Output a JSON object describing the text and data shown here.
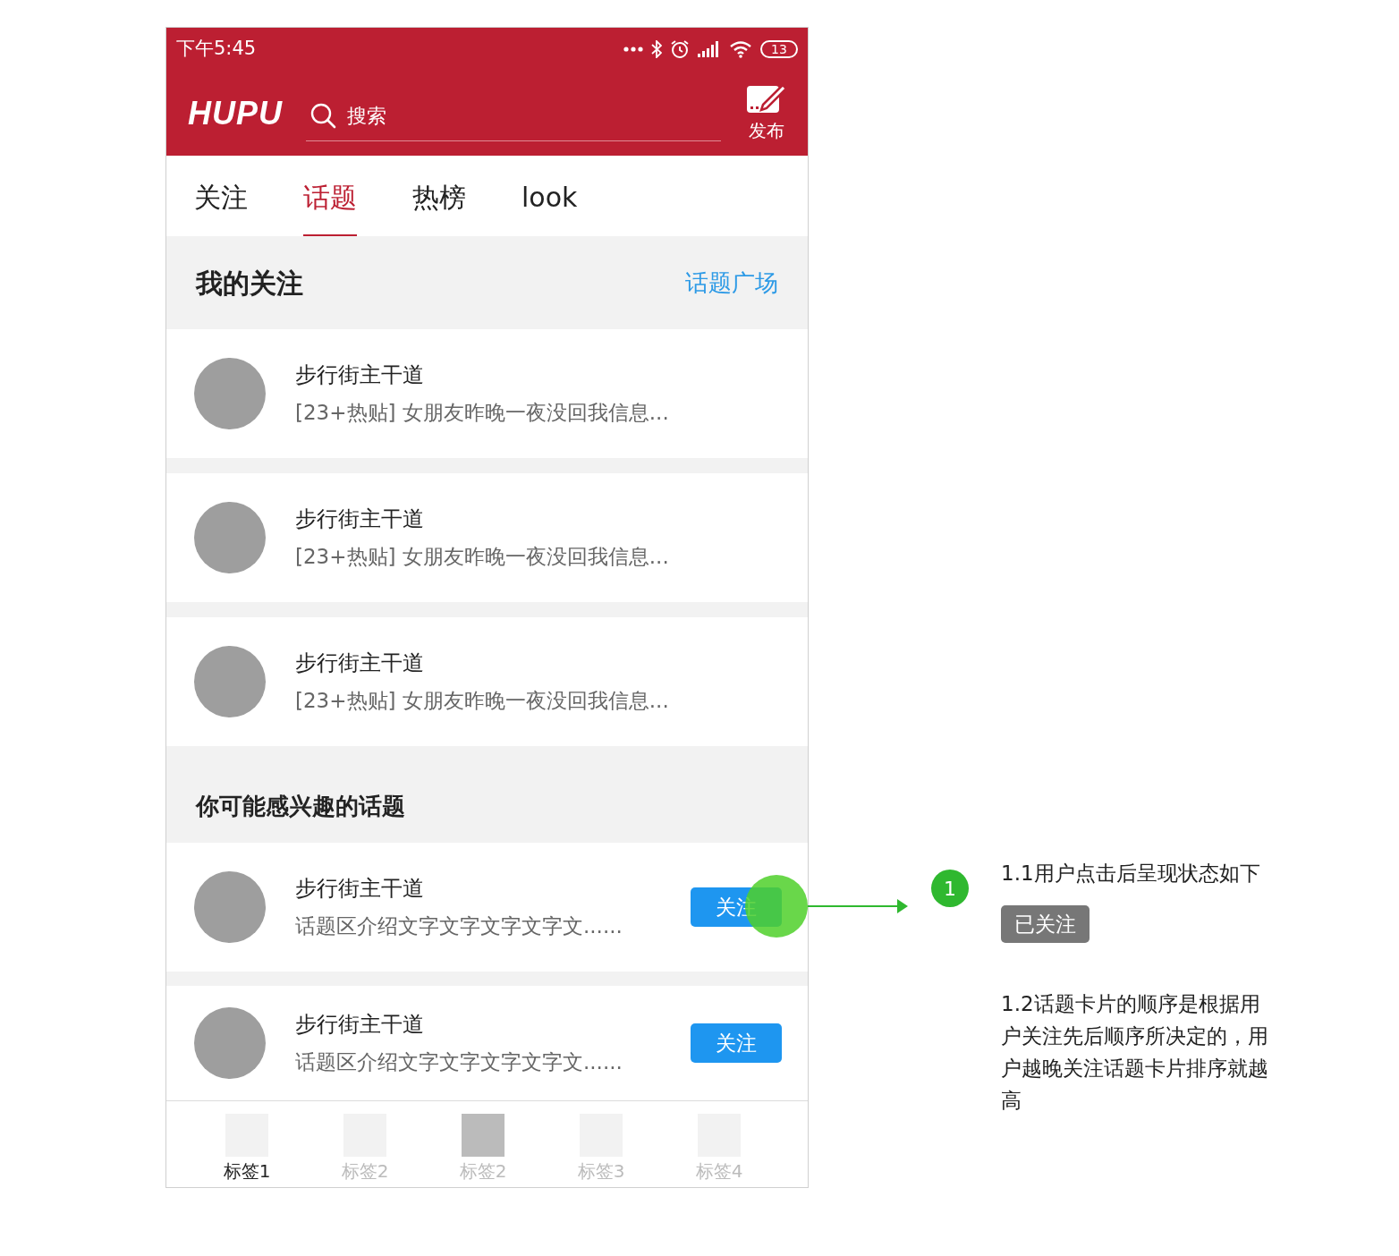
{
  "status_bar": {
    "time": "下午5:45",
    "battery": "13"
  },
  "header": {
    "logo": "HUPU",
    "search": {
      "placeholder": "搜索"
    },
    "publish": "发布"
  },
  "tabs": [
    {
      "label": "关注",
      "selected": false
    },
    {
      "label": "话题",
      "selected": true
    },
    {
      "label": "热榜",
      "selected": false
    },
    {
      "label": "look",
      "selected": false
    }
  ],
  "my_follows": {
    "title": "我的关注",
    "link": "话题广场",
    "items": [
      {
        "title": "步行街主干道",
        "subtitle": "[23+热贴] 女朋友昨晚一夜没回我信息..."
      },
      {
        "title": "步行街主干道",
        "subtitle": "[23+热贴] 女朋友昨晚一夜没回我信息..."
      },
      {
        "title": "步行街主干道",
        "subtitle": "[23+热贴] 女朋友昨晚一夜没回我信息..."
      }
    ]
  },
  "suggested": {
    "title": "你可能感兴趣的话题",
    "items": [
      {
        "title": "步行街主干道",
        "subtitle": "话题区介绍文字文字文字文字文......",
        "button": "关注",
        "touched": true
      },
      {
        "title": "步行街主干道",
        "subtitle": "话题区介绍文字文字文字文字文......",
        "button": "关注",
        "touched": false
      }
    ]
  },
  "bottom_tabs": [
    {
      "label": "标签1",
      "selected": true,
      "icon_dark": false
    },
    {
      "label": "标签2",
      "selected": false,
      "icon_dark": false
    },
    {
      "label": "标签2",
      "selected": false,
      "icon_dark": true
    },
    {
      "label": "标签3",
      "selected": false,
      "icon_dark": false
    },
    {
      "label": "标签4",
      "selected": false,
      "icon_dark": false
    }
  ],
  "annotation": {
    "marker": "1",
    "note_1": "1.1用户点击后呈现状态如下",
    "state_badge": "已关注",
    "note_2": "1.2话题卡片的顺序是根据用户关注先后顺序所决定的，用户越晚关注话题卡片排序就越高"
  }
}
